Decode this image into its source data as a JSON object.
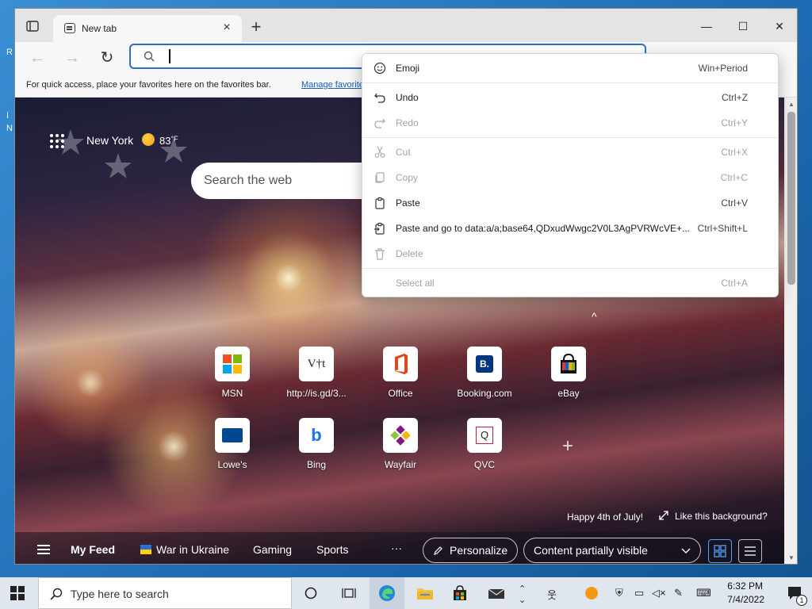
{
  "desktop": {
    "left_glyphs": [
      "R",
      "I",
      "N"
    ]
  },
  "browser": {
    "tab_title": "New tab",
    "tab_close": "×",
    "new_tab": "+",
    "window_controls": {
      "minimize": "—",
      "maximize": "☐",
      "close": "✕"
    },
    "nav": {
      "back": "←",
      "forward": "→",
      "refresh": "↻"
    },
    "address": {
      "value": "",
      "placeholder": ""
    },
    "favorites_bar": {
      "text": "For quick access, place your favorites here on the favorites bar.",
      "link": "Manage favorites now"
    }
  },
  "ntp": {
    "weather": {
      "city": "New York",
      "temp": "83",
      "unit": "°F"
    },
    "search_placeholder": "Search the web",
    "collapse": "^",
    "tiles": [
      {
        "label": "MSN",
        "icon": "msn-icon"
      },
      {
        "label": "http://is.gd/3...",
        "icon": "vt-icon",
        "glyph": "V†t"
      },
      {
        "label": "Office",
        "icon": "office-icon"
      },
      {
        "label": "Booking.com",
        "icon": "booking-icon",
        "glyph": "B."
      },
      {
        "label": "eBay",
        "icon": "ebay-icon"
      },
      {
        "label": "Lowe's",
        "icon": "lowes-icon"
      },
      {
        "label": "Bing",
        "icon": "bing-icon",
        "glyph": "b"
      },
      {
        "label": "Wayfair",
        "icon": "wayfair-icon"
      },
      {
        "label": "QVC",
        "icon": "qvc-icon",
        "glyph": "Q"
      }
    ],
    "add_tile": "+",
    "background_message": "Happy 4th of July!",
    "like_background": "Like this background?",
    "feed": {
      "my_feed": "My Feed",
      "war": "War in Ukraine",
      "gaming": "Gaming",
      "sports": "Sports",
      "more": "···",
      "personalize": "Personalize",
      "content": "Content partially visible"
    }
  },
  "context_menu": {
    "items": [
      {
        "label": "Emoji",
        "shortcut": "Win+Period",
        "icon": "emoji-icon",
        "enabled": true
      },
      {
        "label": "Undo",
        "shortcut": "Ctrl+Z",
        "icon": "undo-icon",
        "enabled": true
      },
      {
        "label": "Redo",
        "shortcut": "Ctrl+Y",
        "icon": "redo-icon",
        "enabled": false
      },
      {
        "label": "Cut",
        "shortcut": "Ctrl+X",
        "icon": "cut-icon",
        "enabled": false
      },
      {
        "label": "Copy",
        "shortcut": "Ctrl+C",
        "icon": "copy-icon",
        "enabled": false
      },
      {
        "label": "Paste",
        "shortcut": "Ctrl+V",
        "icon": "paste-icon",
        "enabled": true
      },
      {
        "label": "Paste and go to data:a/a;base64,QDxudWwgc2V0L3AgPVRWcVE+...",
        "shortcut": "Ctrl+Shift+L",
        "icon": "paste-go-icon",
        "enabled": true
      },
      {
        "label": "Delete",
        "shortcut": "",
        "icon": "delete-icon",
        "enabled": false
      },
      {
        "label": "Select all",
        "shortcut": "Ctrl+A",
        "icon": "",
        "enabled": false
      }
    ]
  },
  "taskbar": {
    "search_placeholder": "Type here to search",
    "clock": {
      "time": "6:32 PM",
      "date": "7/4/2022"
    },
    "notification_count": "1"
  },
  "colors": {
    "accent": "#2f6ec8",
    "link": "#1a5fb4"
  }
}
